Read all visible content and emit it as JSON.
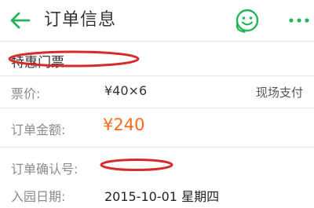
{
  "header": {
    "title": "订单信息",
    "accent_color": "#26b35a",
    "icons": [
      "back-arrow-icon",
      "customer-service-icon",
      "more-icon"
    ]
  },
  "order": {
    "ticket_name": "特惠门票",
    "price_label": "票价:",
    "price_value": "¥40×6",
    "payment_type": "现场支付",
    "amount_label": "订单金额:",
    "amount_value": "¥240",
    "amount_color": "#ff6a1f",
    "confirm_label": "订单确认号:",
    "confirm_value": "",
    "date_label": "入园日期:",
    "date_value": "2015-10-01 星期四"
  },
  "redaction_color": "#d62b2b"
}
